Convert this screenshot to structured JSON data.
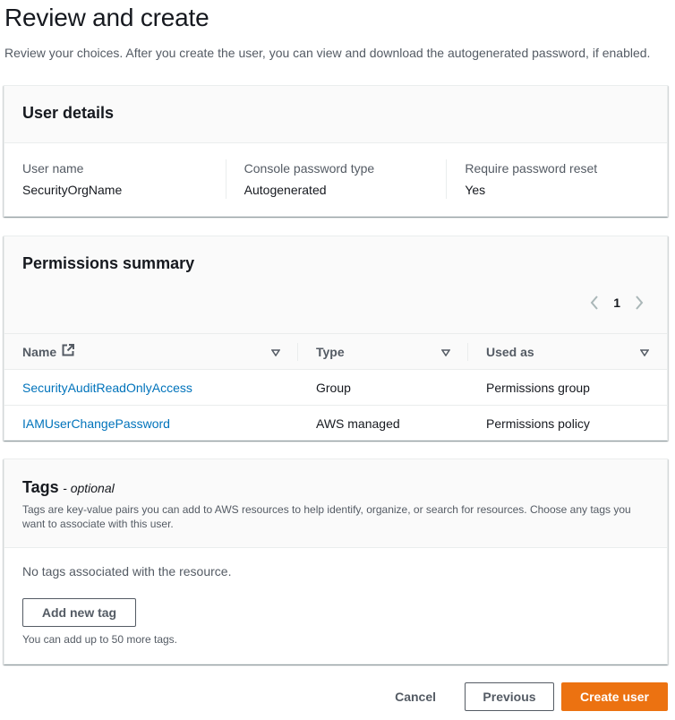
{
  "page": {
    "title": "Review and create",
    "description": "Review your choices. After you create the user, you can view and download the autogenerated password, if enabled."
  },
  "user_details": {
    "title": "User details",
    "fields": [
      {
        "label": "User name",
        "value": "SecurityOrgName"
      },
      {
        "label": "Console password type",
        "value": "Autogenerated"
      },
      {
        "label": "Require password reset",
        "value": "Yes"
      }
    ]
  },
  "permissions": {
    "title": "Permissions summary",
    "pagination": {
      "current_page": "1",
      "prev_icon": "chevron-left-icon",
      "next_icon": "chevron-right-icon"
    },
    "columns": [
      {
        "label": "Name",
        "icon": "external-link-icon"
      },
      {
        "label": "Type"
      },
      {
        "label": "Used as"
      }
    ],
    "rows": [
      {
        "name": "SecurityAuditReadOnlyAccess",
        "type": "Group",
        "used_as": "Permissions group"
      },
      {
        "name": "IAMUserChangePassword",
        "type": "AWS managed",
        "used_as": "Permissions policy"
      }
    ]
  },
  "tags": {
    "title": "Tags",
    "optional": "- optional",
    "description": "Tags are key-value pairs you can add to AWS resources to help identify, organize, or search for resources. Choose any tags you want to associate with this user.",
    "empty_text": "No tags associated with the resource.",
    "add_button": "Add new tag",
    "hint": "You can add up to 50 more tags."
  },
  "footer": {
    "cancel": "Cancel",
    "previous": "Previous",
    "create": "Create user"
  },
  "colors": {
    "link": "#0073bb",
    "primary": "#ec7211",
    "text": "#16191f",
    "secondary_text": "#545b64"
  }
}
